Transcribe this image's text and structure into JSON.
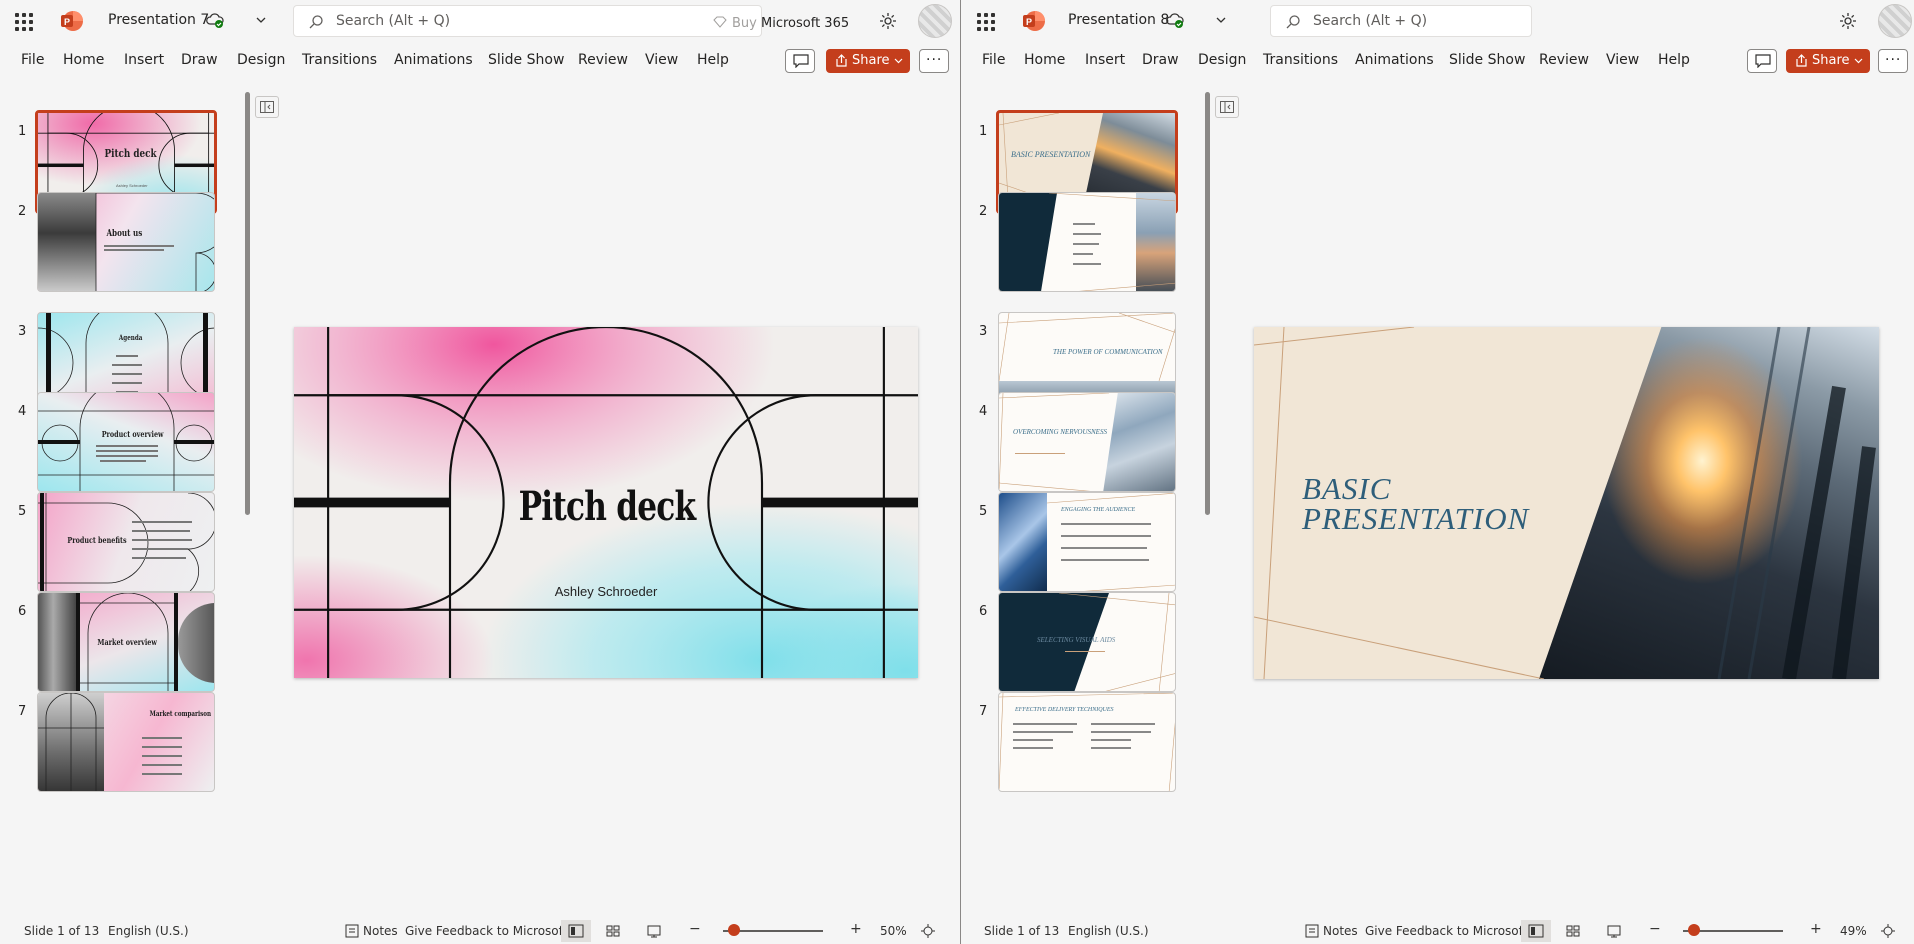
{
  "left": {
    "title": "Presentation 7",
    "search_placeholder": "Search (Alt + Q)",
    "buy_label": "Buy",
    "buy_product": "Microsoft 365",
    "menu": [
      "File",
      "Home",
      "Insert",
      "Draw",
      "Design",
      "Transitions",
      "Animations",
      "Slide Show",
      "Review",
      "View",
      "Help"
    ],
    "share_label": "Share",
    "slides": [
      {
        "n": "1",
        "title": "Pitch deck",
        "sub": "Ashley Schroeder"
      },
      {
        "n": "2",
        "title": "About us"
      },
      {
        "n": "3",
        "title": "Agenda"
      },
      {
        "n": "4",
        "title": "Product overview"
      },
      {
        "n": "5",
        "title": "Product benefits"
      },
      {
        "n": "6",
        "title": "Market overview"
      },
      {
        "n": "7",
        "title": "Market comparison"
      }
    ],
    "main_title": "Pitch deck",
    "main_subtitle": "Ashley Schroeder",
    "status": {
      "slide": "Slide 1 of 13",
      "lang": "English (U.S.)",
      "notes": "Notes",
      "feedback": "Give Feedback to Microsoft",
      "zoom": "50%"
    }
  },
  "right": {
    "title": "Presentation 8",
    "search_placeholder": "Search (Alt + Q)",
    "menu": [
      "File",
      "Home",
      "Insert",
      "Draw",
      "Design",
      "Transitions",
      "Animations",
      "Slide Show",
      "Review",
      "View",
      "Help"
    ],
    "share_label": "Share",
    "slides": [
      {
        "n": "1",
        "title": "BASIC PRESENTATION"
      },
      {
        "n": "2",
        "title": ""
      },
      {
        "n": "3",
        "title": "THE POWER OF COMMUNICATION"
      },
      {
        "n": "4",
        "title": "OVERCOMING NERVOUSNESS"
      },
      {
        "n": "5",
        "title": "ENGAGING THE AUDIENCE"
      },
      {
        "n": "6",
        "title": "SELECTING VISUAL AIDS"
      },
      {
        "n": "7",
        "title": "EFFECTIVE DELIVERY TECHNIQUES"
      }
    ],
    "main_title_line1": "BASIC",
    "main_title_line2": "PRESENTATION",
    "status": {
      "slide": "Slide 1 of 13",
      "lang": "English (U.S.)",
      "notes": "Notes",
      "feedback": "Give Feedback to Microsoft",
      "zoom": "49%"
    }
  },
  "colors": {
    "accent": "#c43e1c",
    "pink": "#f06aa8",
    "cyan": "#8fe3ec",
    "teal_title": "#2e5e7a",
    "cream": "#f1e6d6",
    "navy": "#102a3a",
    "gold": "#c9a07a"
  }
}
